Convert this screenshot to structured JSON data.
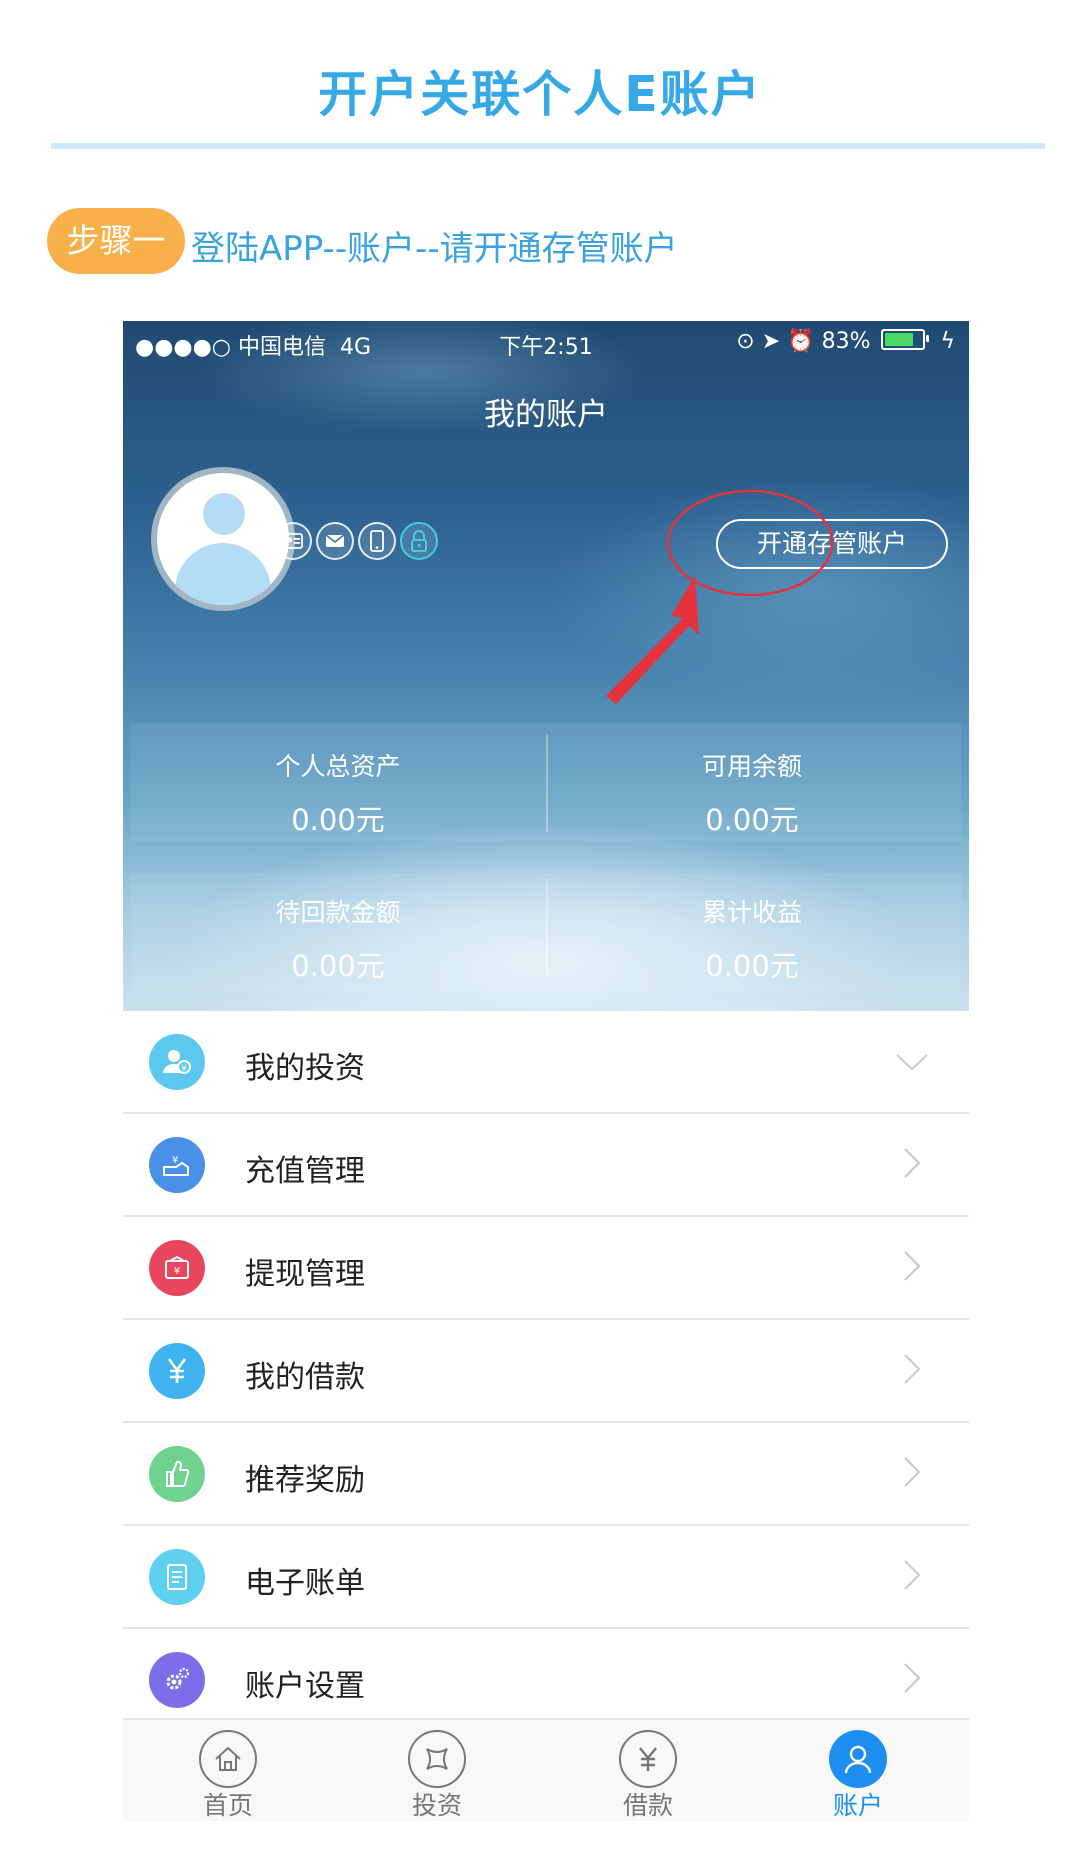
{
  "doc": {
    "title": "开户关联个人E账户",
    "step_badge": "步骤一",
    "step_text": "登陆APP--账户--请开通存管账户"
  },
  "status_bar": {
    "carrier": "●●●●○ 中国电信",
    "network": "4G",
    "time": "下午2:51",
    "battery": "83%",
    "battery_level": 0.83
  },
  "header": {
    "title": "我的账户",
    "open_account_button": "开通存管账户",
    "verify_icons": [
      "id-card-icon",
      "mail-icon",
      "phone-icon",
      "lock-icon"
    ]
  },
  "stats": [
    {
      "label": "个人总资产",
      "value": "0.00元"
    },
    {
      "label": "可用余额",
      "value": "0.00元"
    },
    {
      "label": "待回款金额",
      "value": "0.00元"
    },
    {
      "label": "累计收益",
      "value": "0.00元"
    }
  ],
  "menu": [
    {
      "label": "我的投资",
      "icon": "investor-icon",
      "color": "#5cc8ef"
    },
    {
      "label": "充值管理",
      "icon": "recharge-icon",
      "color": "#4a8fe8"
    },
    {
      "label": "提现管理",
      "icon": "wallet-icon",
      "color": "#e9475d"
    },
    {
      "label": "我的借款",
      "icon": "yuan-icon",
      "color": "#3fb3f0"
    },
    {
      "label": "推荐奖励",
      "icon": "thumbs-up-icon",
      "color": "#6fd38f"
    },
    {
      "label": "电子账单",
      "icon": "bill-icon",
      "color": "#5fd0ef"
    },
    {
      "label": "账户设置",
      "icon": "gear-icon",
      "color": "#7b6ee8"
    }
  ],
  "tabbar": [
    {
      "label": "首页",
      "icon": "home-icon"
    },
    {
      "label": "投资",
      "icon": "invest-icon"
    },
    {
      "label": "借款",
      "icon": "yuan-icon"
    },
    {
      "label": "账户",
      "icon": "user-icon",
      "active": true
    }
  ],
  "colors": {
    "title": "#35a9e6",
    "step_badge": "#f8b04a",
    "active_tab": "#1e8ff0",
    "annotation": "#e5323c"
  }
}
